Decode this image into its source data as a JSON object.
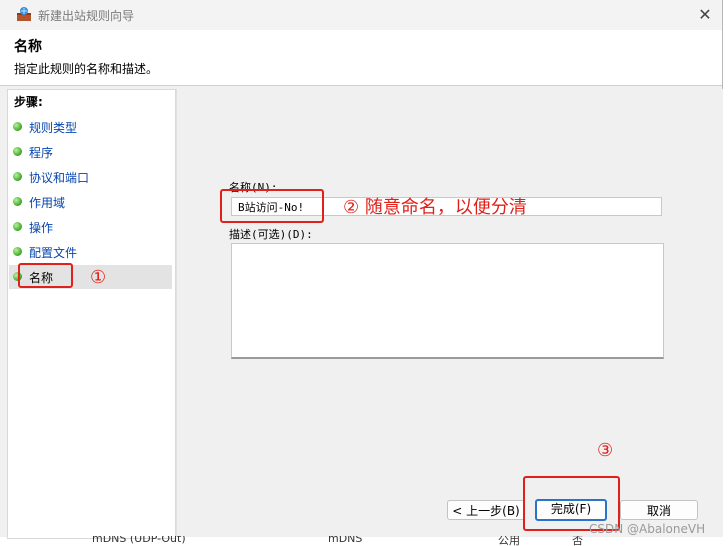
{
  "window": {
    "title": "新建出站规则向导",
    "close_glyph": "✕"
  },
  "header": {
    "title": "名称",
    "description": "指定此规则的名称和描述。"
  },
  "sidebar": {
    "title": "步骤:",
    "steps": [
      {
        "label": "规则类型"
      },
      {
        "label": "程序"
      },
      {
        "label": "协议和端口"
      },
      {
        "label": "作用域"
      },
      {
        "label": "操作"
      },
      {
        "label": "配置文件"
      },
      {
        "label": "名称",
        "active": true
      }
    ]
  },
  "form": {
    "name_label": "名称(N):",
    "name_value": "B站访问-No!",
    "desc_label": "描述(可选)(D):",
    "desc_value": ""
  },
  "buttons": {
    "back": "< 上一步(B)",
    "finish": "完成(F)",
    "cancel": "取消"
  },
  "annotations": {
    "one": "①",
    "two": "② 随意命名，以便分清",
    "three": "③",
    "color": "#e0201a"
  },
  "background": {
    "row_text_1": "mDNS (UDP-Out)",
    "row_text_2": "mDNS",
    "row_text_3": "公用",
    "row_text_4": "否"
  },
  "watermark": "CSDN @AbaloneVH"
}
